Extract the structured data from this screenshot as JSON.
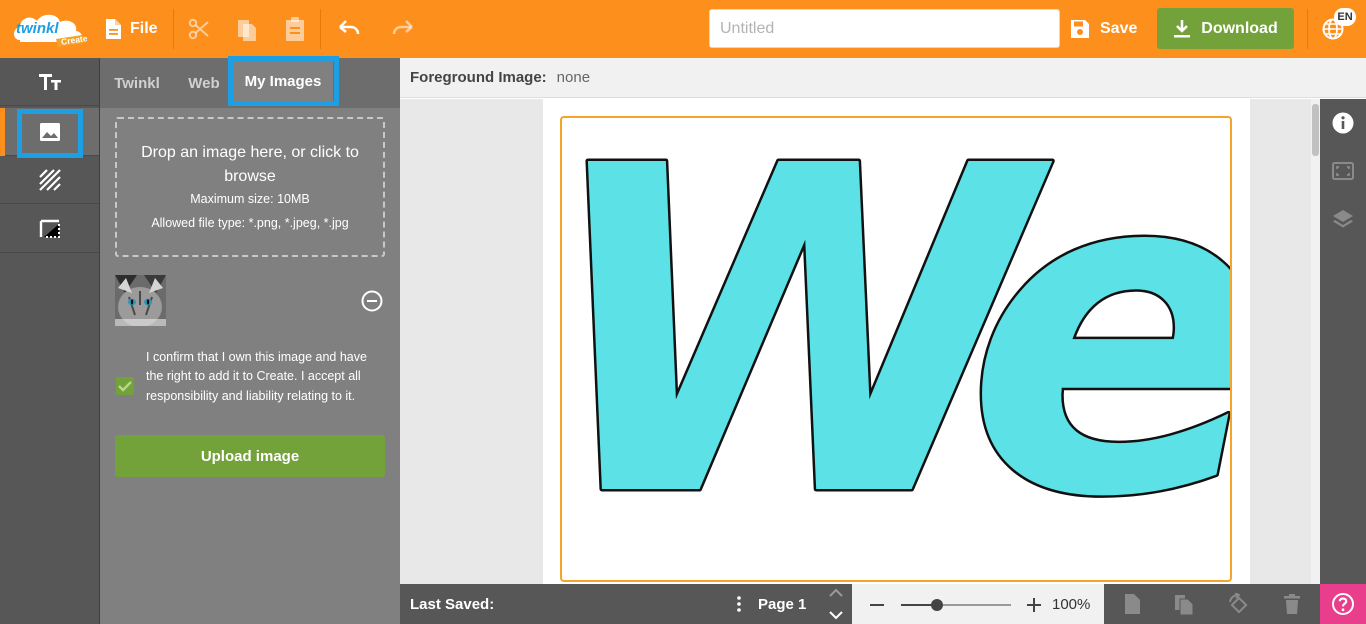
{
  "app": {
    "brand": "twinkl",
    "brand_sub": "Create",
    "language": "EN"
  },
  "topbar": {
    "file_label": "File",
    "title_placeholder": "Untitled",
    "title_value": "",
    "save_label": "Save",
    "download_label": "Download"
  },
  "images_panel": {
    "tabs": [
      {
        "label": "Twinkl"
      },
      {
        "label": "Web"
      },
      {
        "label": "My Images",
        "active": true
      }
    ],
    "dropzone": {
      "main": "Drop an image here, or click to browse",
      "max_size": "Maximum size: 10MB",
      "file_types": "Allowed file type: *.png, *.jpeg, *.jpg"
    },
    "confirm_text": "I confirm that I own this image and have the right to add it to Create. I accept all responsibility and liability relating to it.",
    "confirm_checked": true,
    "upload_label": "Upload image"
  },
  "canvas": {
    "foreground_label": "Foreground Image:",
    "foreground_value": "none",
    "text": "We",
    "text_fill": "#5ce1e6",
    "frame_color": "#f5a32a"
  },
  "bottombar": {
    "last_saved_label": "Last Saved:",
    "page_label": "Page 1",
    "zoom_level": "100%",
    "zoom_fraction": 0.33
  },
  "colors": {
    "accent": "#fd8f1c",
    "primary_button": "#73a13a",
    "highlight": "#1d9fe3",
    "help": "#e83e8c"
  }
}
